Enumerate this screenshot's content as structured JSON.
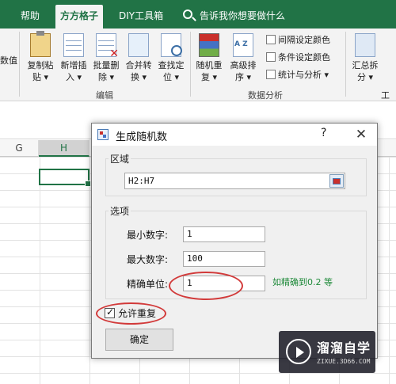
{
  "tabs": [
    {
      "label": "帮助"
    },
    {
      "label": "方方格子",
      "active": true
    },
    {
      "label": "DIY工具箱"
    }
  ],
  "tell_me": "告诉我你想要做什么",
  "ribbon": {
    "left_edge_label": "数值",
    "edit_buttons": [
      {
        "label": "复制粘贴",
        "line1": "复制粘",
        "line2": "贴 ▾",
        "icon": "paste-icon"
      },
      {
        "label": "新增插入",
        "line1": "新增插",
        "line2": "入 ▾",
        "icon": "insert-table-icon"
      },
      {
        "label": "批量删除",
        "line1": "批量删",
        "line2": "除 ▾",
        "icon": "delete-icon"
      },
      {
        "label": "合并转换",
        "line1": "合并转",
        "line2": "换 ▾",
        "icon": "merge-icon"
      },
      {
        "label": "查找定位",
        "line1": "查找定",
        "line2": "位 ▾",
        "icon": "find-icon"
      }
    ],
    "edit_group_label": "编辑",
    "data_buttons": [
      {
        "label": "随机重复",
        "line1": "随机重",
        "line2": "复 ▾",
        "icon": "random-icon"
      },
      {
        "label": "高级排序",
        "line1": "高级排",
        "line2": "序 ▾",
        "icon": "sort-icon"
      }
    ],
    "data_small_buttons": [
      {
        "label": "间隔设定颜色"
      },
      {
        "label": "条件设定颜色"
      },
      {
        "label": "统计与分析 ▾"
      }
    ],
    "data_group_label": "数据分析",
    "right_buttons": [
      {
        "line1": "汇总拆",
        "line2": "分 ▾",
        "icon": "split-icon"
      }
    ],
    "right_edge_label": "工作"
  },
  "sheet": {
    "columns": [
      "G",
      "H"
    ],
    "selected_column": "H"
  },
  "dialog": {
    "title": "生成随机数",
    "help": "?",
    "close": "✕",
    "range_legend": "区域",
    "range_value": "H2:H7",
    "options_legend": "选项",
    "min_label": "最小数字:",
    "min_value": "1",
    "max_label": "最大数字:",
    "max_value": "100",
    "precision_label": "精确单位:",
    "precision_value": "1",
    "precision_hint": "如精确到0.2 等",
    "allow_repeat_label": "允许重复",
    "allow_repeat_checked": true,
    "ok_label": "确定"
  },
  "watermark": {
    "title": "溜溜自学",
    "subtitle": "ZIXUE.3D66.COM"
  },
  "colors": {
    "excel_green": "#217346",
    "annotation_red": "#d23a3a",
    "hint_green": "#1f8a3a"
  }
}
